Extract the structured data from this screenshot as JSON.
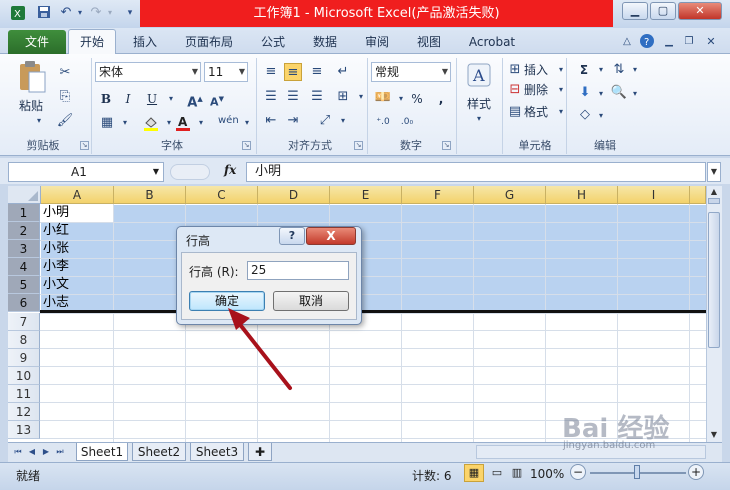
{
  "titlebar": {
    "title": "工作簿1 - Microsoft Excel(产品激活失败)"
  },
  "tabs": [
    {
      "label": "文件"
    },
    {
      "label": "开始"
    },
    {
      "label": "插入"
    },
    {
      "label": "页面布局"
    },
    {
      "label": "公式"
    },
    {
      "label": "数据"
    },
    {
      "label": "审阅"
    },
    {
      "label": "视图"
    },
    {
      "label": "Acrobat"
    }
  ],
  "ribbon": {
    "paste": "粘贴",
    "font_name": "宋体",
    "font_size": "11",
    "number_format": "常规",
    "style": "样式",
    "insert": "插入",
    "delete": "删除",
    "format": "格式",
    "bold": "B",
    "italic": "I",
    "underline": "U",
    "percent": "%",
    "comma": ",",
    "sigma": "Σ",
    "groups": {
      "clipboard": "剪贴板",
      "font": "字体",
      "alignment": "对齐方式",
      "number": "数字",
      "cells": "单元格",
      "editing": "编辑"
    }
  },
  "formula_bar": {
    "name_box": "A1",
    "fx": "fx",
    "content": "小明"
  },
  "columns": [
    "A",
    "B",
    "C",
    "D",
    "E",
    "F",
    "G",
    "H",
    "I"
  ],
  "rows": [
    "1",
    "2",
    "3",
    "4",
    "5",
    "6",
    "7",
    "8",
    "9",
    "10",
    "11",
    "12",
    "13"
  ],
  "cells_a": [
    "小明",
    "小红",
    "小张",
    "小李",
    "小文",
    "小志"
  ],
  "sheets": [
    "Sheet1",
    "Sheet2",
    "Sheet3"
  ],
  "status": {
    "ready": "就绪",
    "count": "计数: 6",
    "zoom": "100%"
  },
  "dialog": {
    "title": "行高",
    "label": "行高 (R):",
    "value": "25",
    "ok": "确定",
    "cancel": "取消",
    "help": "?",
    "close": "X"
  },
  "watermark": {
    "text": "Bai 经验",
    "url": "jingyan.baidu.com"
  }
}
